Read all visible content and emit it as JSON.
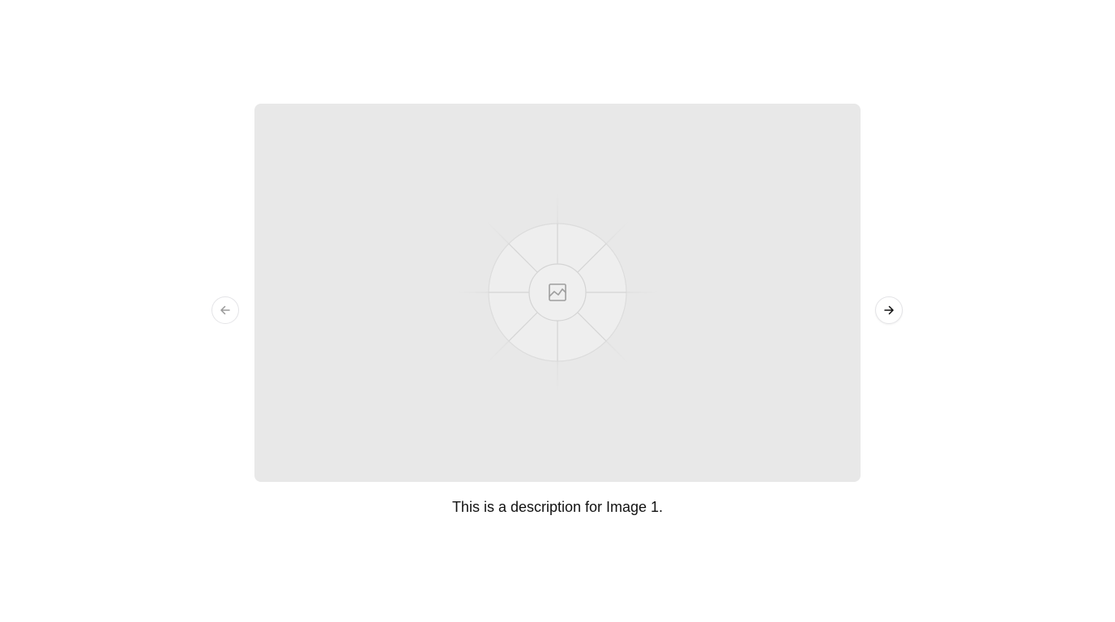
{
  "carousel": {
    "prev_button": {
      "icon": "arrow-left-icon",
      "state": "disabled"
    },
    "next_button": {
      "icon": "arrow-right-icon",
      "state": "enabled"
    },
    "slide": {
      "placeholder_icon": "image-icon",
      "background_color": "#e8e8e8"
    },
    "caption": "This is a description for Image 1."
  }
}
